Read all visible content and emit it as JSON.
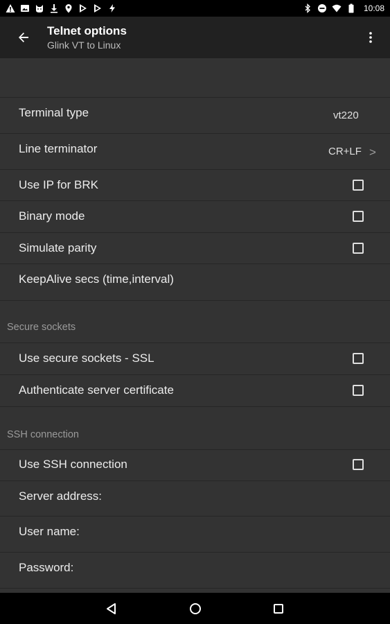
{
  "status_bar": {
    "left_icons": [
      "warning-icon",
      "image-icon",
      "cat-icon",
      "download-icon",
      "location-pin-icon",
      "play-store-icon",
      "play-store-icon",
      "flash-icon"
    ],
    "right_icons": [
      "bluetooth-icon",
      "do-not-disturb-icon",
      "wifi-icon",
      "battery-icon"
    ],
    "time": "10:08"
  },
  "app_bar": {
    "title": "Telnet options",
    "subtitle": "Glink VT to Linux"
  },
  "settings": {
    "terminal_type": {
      "label": "Terminal type",
      "value": "vt220"
    },
    "line_terminator": {
      "label": "Line terminator",
      "value": "CR+LF",
      "chevron": ">"
    },
    "use_ip_brk": {
      "label": "Use IP for BRK",
      "checked": false
    },
    "binary_mode": {
      "label": "Binary mode",
      "checked": false
    },
    "simulate_parity": {
      "label": "Simulate parity",
      "checked": false
    },
    "keepalive": {
      "label": "KeepAlive secs (time,interval)"
    }
  },
  "secure_sockets": {
    "header": "Secure sockets",
    "use_ssl": {
      "label": "Use secure sockets - SSL",
      "checked": false
    },
    "auth_cert": {
      "label": "Authenticate server certificate",
      "checked": false
    }
  },
  "ssh": {
    "header": "SSH connection",
    "use_ssh": {
      "label": "Use SSH connection",
      "checked": false
    },
    "server_address": {
      "label": "Server address:"
    },
    "user_name": {
      "label": "User name:"
    },
    "password": {
      "label": "Password:"
    }
  },
  "colors": {
    "app_bar": "#212121",
    "background": "#333333",
    "section_header": "#9a9a9a"
  }
}
